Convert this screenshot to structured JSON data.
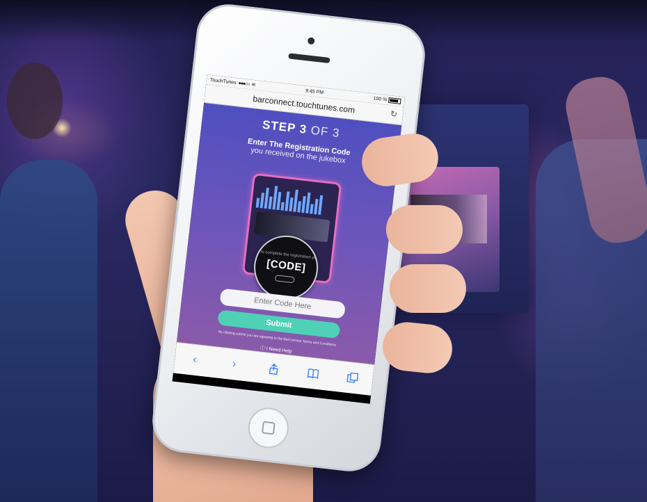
{
  "browser": {
    "carrier": "TouchTunes",
    "signal": "●●●○○",
    "wifi": "≋",
    "time": "9:45 PM",
    "battery": "100 %",
    "url": "barconnect.touchtunes.com",
    "reload_icon": "↻"
  },
  "page": {
    "step_label": "STEP 3",
    "step_of": "OF 3",
    "heading": "Enter The Registration Code",
    "subheading": "you received on the jukebox",
    "device_prompt": "To complete the registration process using the following code:",
    "code": "[CODE]",
    "input_placeholder": "Enter Code Here",
    "submit_label": "Submit",
    "terms": "By clicking submit you are agreeing to the BarConnect Terms and Conditions",
    "help": "ⓘ I Need Help"
  },
  "toolbar": {
    "back_icon": "‹",
    "forward_icon": "›"
  },
  "colors": {
    "gradient_top": "#4f4fc0",
    "gradient_bottom": "#8a5aaa",
    "submit": "#4fd1b6",
    "device_border": "#e66dc4"
  }
}
